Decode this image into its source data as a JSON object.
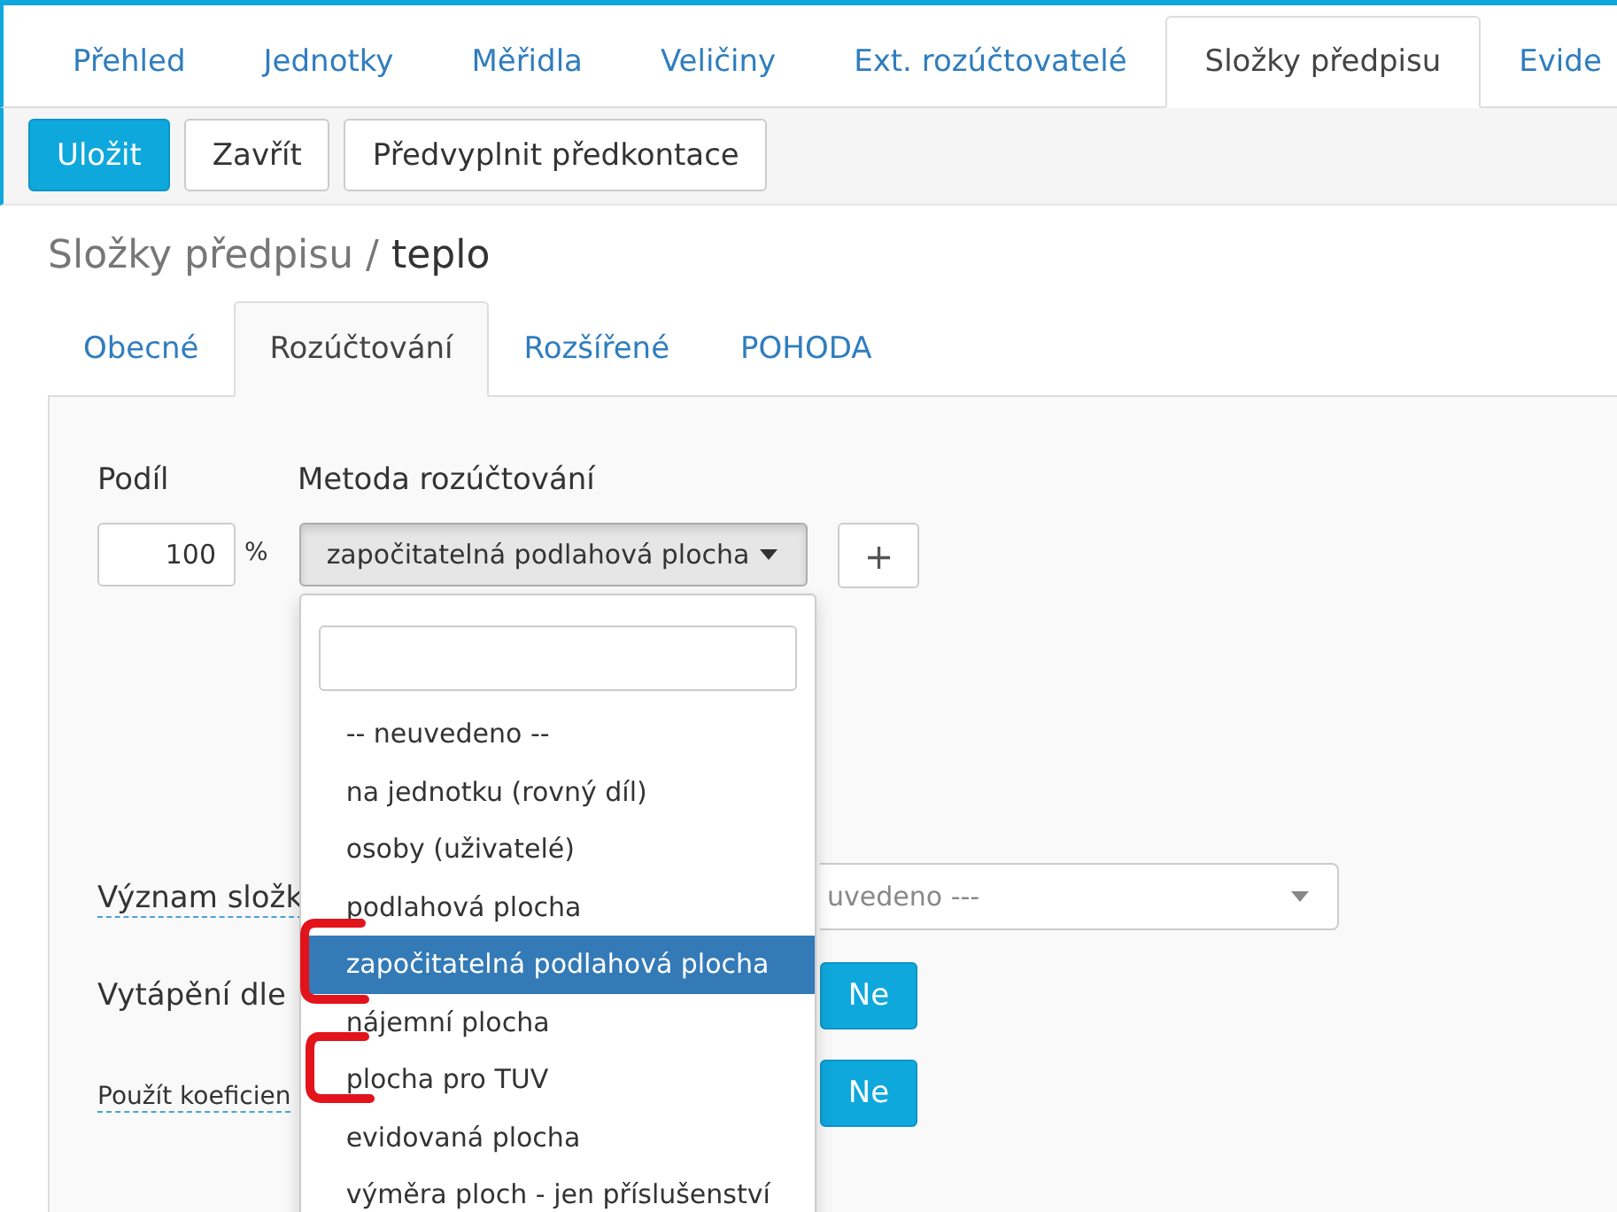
{
  "nav_tabs": [
    {
      "label": "Přehled",
      "selected": false
    },
    {
      "label": "Jednotky",
      "selected": false
    },
    {
      "label": "Měřidla",
      "selected": false
    },
    {
      "label": "Veličiny",
      "selected": false
    },
    {
      "label": "Ext. rozúčtovatelé",
      "selected": false
    },
    {
      "label": "Složky předpisu",
      "selected": true
    },
    {
      "label": "Evide",
      "selected": false
    }
  ],
  "toolbar": [
    {
      "label": "Uložit",
      "kind": "primary"
    },
    {
      "label": "Zavřít",
      "kind": "default"
    },
    {
      "label": "Předvyplnit předkontace",
      "kind": "default"
    }
  ],
  "heading": {
    "path": "Složky předpisu /",
    "current": "teplo"
  },
  "sub_tabs": [
    {
      "label": "Obecné",
      "selected": false
    },
    {
      "label": "Rozúčtování",
      "selected": true
    },
    {
      "label": "Rozšířené",
      "selected": false
    },
    {
      "label": "POHODA",
      "selected": false
    }
  ],
  "share": {
    "label": "Podíl",
    "value": "100",
    "unit": "%"
  },
  "method": {
    "label": "Metoda rozúčtování",
    "value": "započitatelná podlahová plocha",
    "add": "+",
    "open": true
  },
  "dropdown_items": [
    {
      "label": "-- neuvedeno --",
      "selected": false
    },
    {
      "label": "na jednotku (rovný díl)",
      "selected": false
    },
    {
      "label": "osoby (uživatelé)",
      "selected": false
    },
    {
      "label": "podlahová plocha",
      "selected": false
    },
    {
      "label": "započitatelná podlahová plocha",
      "selected": true
    },
    {
      "label": "nájemní plocha",
      "selected": false
    },
    {
      "label": "plocha pro TUV",
      "selected": false
    },
    {
      "label": "evidovaná plocha",
      "selected": false
    },
    {
      "label": "výměra ploch - jen příslušenství",
      "selected": false
    }
  ],
  "fields": [
    {
      "label": "Význam složk",
      "kind": "select",
      "placeholder": "uvedeno ---",
      "hint": true,
      "small": false
    },
    {
      "label": "Vytápění dle",
      "kind": "toggle",
      "value": "Ne",
      "hint": false,
      "small": false
    },
    {
      "label": "Použít koeficien",
      "kind": "toggle",
      "value": "Ne",
      "hint": true,
      "small": true
    }
  ]
}
